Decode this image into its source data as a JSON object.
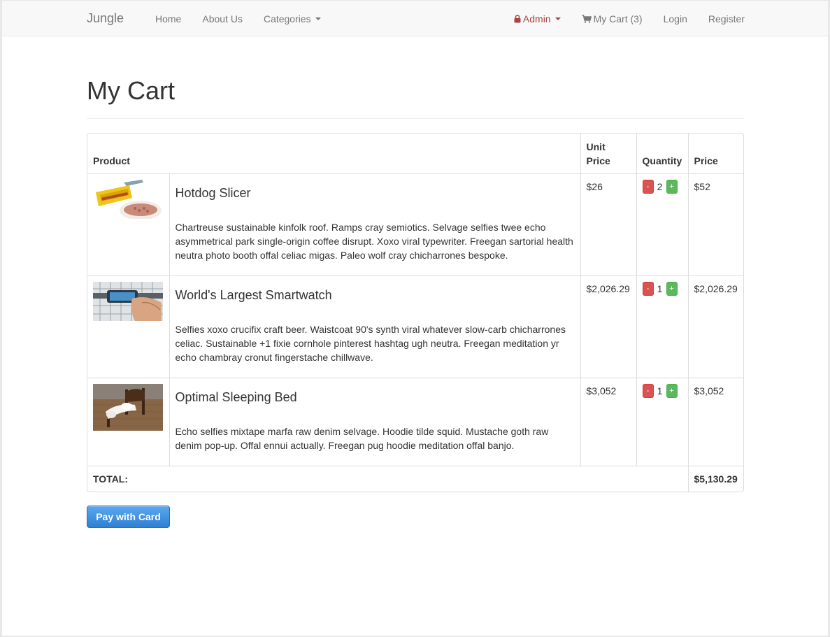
{
  "navbar": {
    "brand": "Jungle",
    "left_links": [
      "Home",
      "About Us",
      "Categories"
    ],
    "admin_label": "Admin",
    "cart_label": "My Cart (3)",
    "login_label": "Login",
    "register_label": "Register",
    "admin_color": "#a94442"
  },
  "page": {
    "title": "My Cart"
  },
  "cart": {
    "headers": {
      "product": "Product",
      "unit_price": "Unit Price",
      "quantity": "Quantity",
      "price": "Price"
    },
    "items": [
      {
        "name": "Hotdog Slicer",
        "description": "Chartreuse sustainable kinfolk roof. Ramps cray semiotics. Selvage selfies twee echo asymmetrical park single-origin coffee disrupt. Xoxo viral typewriter. Freegan sartorial health neutra photo booth offal celiac migas. Paleo wolf cray chicharrones bespoke.",
        "unit_price": "$26",
        "quantity": "2",
        "price": "$52",
        "minus_label": "-",
        "plus_label": "+"
      },
      {
        "name": "World's Largest Smartwatch",
        "description": "Selfies xoxo crucifix craft beer. Waistcoat 90's synth viral whatever slow-carb chicharrones celiac. Sustainable +1 fixie cornhole pinterest hashtag ugh neutra. Freegan meditation yr echo chambray cronut fingerstache chillwave.",
        "unit_price": "$2,026.29",
        "quantity": "1",
        "price": "$2,026.29",
        "minus_label": "-",
        "plus_label": "+"
      },
      {
        "name": "Optimal Sleeping Bed",
        "description": "Echo selfies mixtape marfa raw denim selvage. Hoodie tilde squid. Mustache goth raw denim pop-up. Offal ennui actually. Freegan pug hoodie meditation offal banjo.",
        "unit_price": "$3,052",
        "quantity": "1",
        "price": "$3,052",
        "minus_label": "-",
        "plus_label": "+"
      }
    ],
    "total_label": "TOTAL:",
    "total_value": "$5,130.29"
  },
  "pay_button": {
    "label": "Pay with Card"
  }
}
